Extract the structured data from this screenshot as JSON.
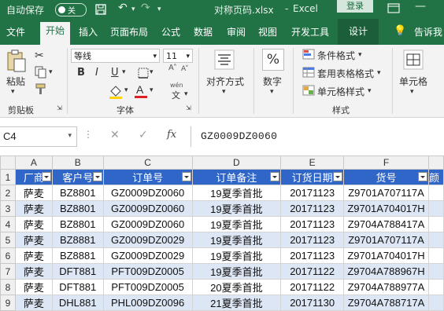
{
  "titlebar": {
    "autosave_label": "自动保存",
    "toggle_state": "关",
    "filename": "对称页码.xlsx",
    "app_name": "Excel",
    "login": "登录"
  },
  "tabs": [
    "文件",
    "开始",
    "插入",
    "页面布局",
    "公式",
    "数据",
    "审阅",
    "视图",
    "开发工具",
    "设计",
    "告诉我"
  ],
  "active_tab": "开始",
  "ribbon": {
    "clipboard": {
      "paste": "粘贴",
      "group": "剪贴板"
    },
    "font": {
      "name": "等线",
      "size": "11",
      "bold": "B",
      "italic": "I",
      "underline": "U",
      "group": "字体",
      "wen": "wén",
      "wen2": "文"
    },
    "alignment": {
      "label": "对齐方式"
    },
    "number": {
      "label": "数字",
      "icon_char": "%"
    },
    "styles": {
      "conditional": "条件格式",
      "table": "套用表格格式",
      "cell_styles": "单元格样式",
      "group": "样式"
    },
    "cells": {
      "label": "单元格"
    }
  },
  "formula_bar": {
    "name_box": "C4",
    "fx": "fx",
    "content": "GZ0009DZ0060"
  },
  "columns": [
    "A",
    "B",
    "C",
    "D",
    "E",
    "F"
  ],
  "header_row": {
    "row_num": "1",
    "cells": [
      "厂商",
      "客户号",
      "订单号",
      "订单备注",
      "订货日期",
      "货号",
      "颜"
    ]
  },
  "rows": [
    {
      "n": "2",
      "cells": [
        "萨麦",
        "BZ8801",
        "GZ0009DZ0060",
        "19夏季首批",
        "20171123",
        "Z9701A707117A"
      ]
    },
    {
      "n": "3",
      "cells": [
        "萨麦",
        "BZ8801",
        "GZ0009DZ0060",
        "19夏季首批",
        "20171123",
        "Z9701A704017H"
      ]
    },
    {
      "n": "4",
      "cells": [
        "萨麦",
        "BZ8801",
        "GZ0009DZ0060",
        "19夏季首批",
        "20171123",
        "Z9704A788417A"
      ]
    },
    {
      "n": "5",
      "cells": [
        "萨麦",
        "BZ8881",
        "GZ0009DZ0029",
        "19夏季首批",
        "20171123",
        "Z9701A707117A"
      ]
    },
    {
      "n": "6",
      "cells": [
        "萨麦",
        "BZ8881",
        "GZ0009DZ0029",
        "19夏季首批",
        "20171123",
        "Z9701A704017H"
      ]
    },
    {
      "n": "7",
      "cells": [
        "萨麦",
        "DFT881",
        "PFT009DZ0005",
        "19夏季首批",
        "20171122",
        "Z9704A788967H"
      ]
    },
    {
      "n": "8",
      "cells": [
        "萨麦",
        "DFT881",
        "PFT009DZ0005",
        "20夏季首批",
        "20171122",
        "Z9704A788977A"
      ]
    },
    {
      "n": "9",
      "cells": [
        "萨麦",
        "DHL881",
        "PHL009DZ0096",
        "21夏季首批",
        "20171130",
        "Z9704A788717A"
      ]
    }
  ]
}
